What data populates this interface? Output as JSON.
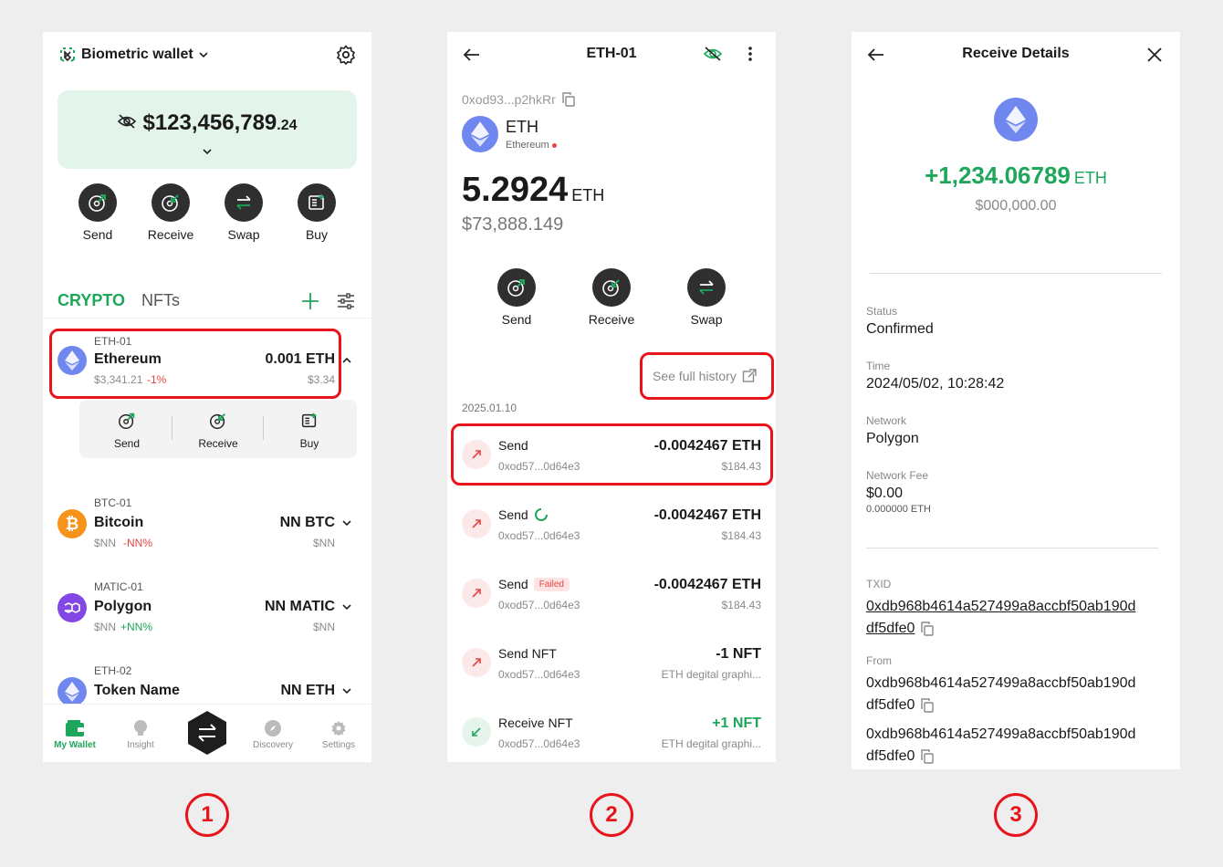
{
  "screen1": {
    "wallet_name": "Biometric wallet",
    "balance_main": "$123,456,789",
    "balance_cents": ".24",
    "actions": [
      "Send",
      "Receive",
      "Swap",
      "Buy"
    ],
    "tabs": {
      "crypto": "CRYPTO",
      "nfts": "NFTs"
    },
    "assets": [
      {
        "tag": "ETH-01",
        "name": "Ethereum",
        "price": "$3,341.21",
        "change": "-1%",
        "amount": "0.001 ETH",
        "fiat": "$3.34"
      },
      {
        "tag": "BTC-01",
        "name": "Bitcoin",
        "price": "$NN",
        "change": "-NN%",
        "amount": "NN BTC",
        "fiat": "$NN"
      },
      {
        "tag": "MATIC-01",
        "name": "Polygon",
        "price": "$NN",
        "change": "+NN%",
        "amount": "NN MATIC",
        "fiat": "$NN"
      },
      {
        "tag": "ETH-02",
        "name": "Token Name",
        "amount": "NN ETH"
      }
    ],
    "expanded_actions": [
      "Send",
      "Receive",
      "Buy"
    ],
    "nav": [
      "My Wallet",
      "Insight",
      "Discovery",
      "Settings"
    ],
    "colors": {
      "accent": "#1ea65b",
      "balance_card": "#e3f4ea"
    }
  },
  "screen2": {
    "title": "ETH-01",
    "address": "0xod93...p2hkRr",
    "coin": "ETH",
    "network": "Ethereum",
    "balance": "5.2924",
    "balance_unit": "ETH",
    "fiat": "$73,888.149",
    "actions": [
      "Send",
      "Receive",
      "Swap"
    ],
    "history_link": "See full history",
    "date": "2025.01.10",
    "transactions": [
      {
        "title": "Send",
        "addr": "0xod57...0d64e3",
        "amount": "-0.0042467 ETH",
        "fiat": "$184.43",
        "kind": "send"
      },
      {
        "title": "Send",
        "addr": "0xod57...0d64e3",
        "amount": "-0.0042467 ETH",
        "fiat": "$184.43",
        "kind": "send"
      },
      {
        "title": "Send",
        "badge": "Failed",
        "addr": "0xod57...0d64e3",
        "amount": "-0.0042467 ETH",
        "fiat": "$184.43",
        "kind": "send"
      },
      {
        "title": "Send NFT",
        "addr": "0xod57...0d64e3",
        "amount": "-1 NFT",
        "fiat": "ETH degital graphi...",
        "kind": "send"
      },
      {
        "title": "Receive NFT",
        "addr": "0xod57...0d64e3",
        "amount": "+1 NFT",
        "fiat": "ETH degital graphi...",
        "kind": "receive"
      }
    ]
  },
  "screen3": {
    "title": "Receive Details",
    "amount": "+1,234.06789",
    "unit": "ETH",
    "fiat": "$000,000.00",
    "fields": [
      {
        "label": "Status",
        "value": "Confirmed"
      },
      {
        "label": "Time",
        "value": "2024/05/02, 10:28:42"
      },
      {
        "label": "Network",
        "value": "Polygon"
      },
      {
        "label": "Network Fee",
        "value": "$0.00",
        "sub": "0.000000 ETH"
      }
    ],
    "txid_label": "TXID",
    "txid_1": "0xdb968b4614a527499a8accbf50ab190d",
    "txid_2": "df5dfe0",
    "from_label": "From",
    "from_1": "0xdb968b4614a527499a8accbf50ab190d",
    "from_2": "df5dfe0",
    "to_1": "0xdb968b4614a527499a8accbf50ab190d",
    "to_2": "df5dfe0"
  },
  "steps": [
    "1",
    "2",
    "3"
  ]
}
